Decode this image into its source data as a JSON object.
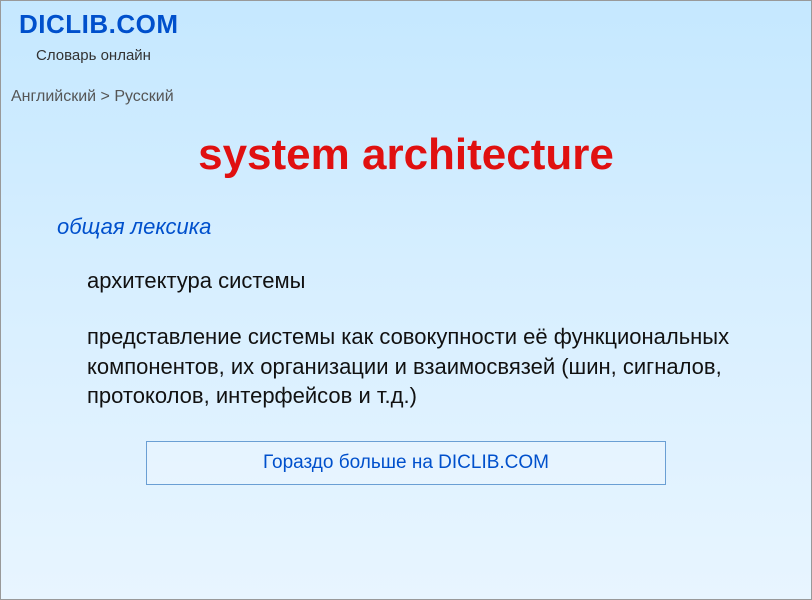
{
  "header": {
    "site_title": "DICLIB.COM",
    "tagline": "Словарь онлайн"
  },
  "breadcrumb": {
    "text": "Английский > Русский"
  },
  "entry": {
    "title": "system architecture",
    "category": "общая лексика",
    "definition_short": "архитектура системы",
    "definition_long": "представление системы как совокупности её функциональных компонентов, их организации и взаимосвязей (шин, сигналов, протоколов, интерфейсов и т.д.)"
  },
  "cta": {
    "label": "Гораздо больше на DICLIB.COM"
  }
}
